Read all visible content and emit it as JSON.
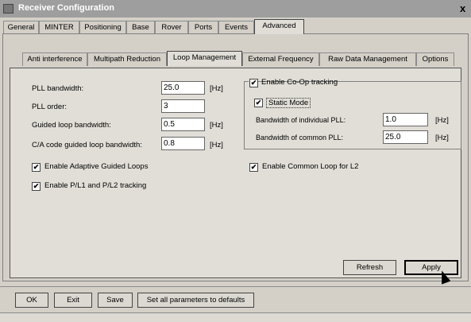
{
  "window": {
    "title": "Receiver Configuration",
    "close_label": "x"
  },
  "main_tabs": [
    {
      "label": "General"
    },
    {
      "label": "MINTER"
    },
    {
      "label": "Positioning"
    },
    {
      "label": "Base"
    },
    {
      "label": "Rover"
    },
    {
      "label": "Ports"
    },
    {
      "label": "Events"
    },
    {
      "label": "Advanced",
      "active": true
    }
  ],
  "sub_tabs": [
    {
      "label": "Anti interference"
    },
    {
      "label": "Multipath Reduction"
    },
    {
      "label": "Loop Management",
      "active": true
    },
    {
      "label": "External Frequency"
    },
    {
      "label": "Raw Data Management"
    },
    {
      "label": "Options"
    }
  ],
  "loop_params": [
    {
      "label": "PLL bandwidth:",
      "value": "25.0",
      "unit": "[Hz]"
    },
    {
      "label": "PLL order:",
      "value": "3",
      "unit": ""
    },
    {
      "label": "Guided loop bandwidth:",
      "value": "0.5",
      "unit": "[Hz]"
    },
    {
      "label": "C/A code guided loop bandwidth:",
      "value": "0.8",
      "unit": "[Hz]"
    }
  ],
  "left_checks": [
    {
      "label": "Enable Adaptive Guided Loops",
      "checked": true,
      "mark": "✔"
    },
    {
      "label": "Enable P/L1 and P/L2 tracking",
      "checked": true,
      "mark": "✔"
    }
  ],
  "coop": {
    "enable_label": "Enable Co-Op tracking",
    "enable_mark": "✔",
    "static_label": "Static Mode",
    "static_mark": "✔",
    "individual_label": "Bandwidth of individual PLL:",
    "individual_value": "1.0",
    "individual_unit": "[Hz]",
    "common_label": "Bandwidth of common PLL:",
    "common_value": "25.0",
    "common_unit": "[Hz]"
  },
  "common_loop": {
    "label": "Enable Common Loop for L2",
    "checked": true,
    "mark": "✔"
  },
  "panel_buttons": {
    "refresh": "Refresh",
    "apply": "Apply"
  },
  "bottom_buttons": {
    "ok": "OK",
    "exit": "Exit",
    "save": "Save",
    "defaults": "Set all parameters to defaults"
  }
}
